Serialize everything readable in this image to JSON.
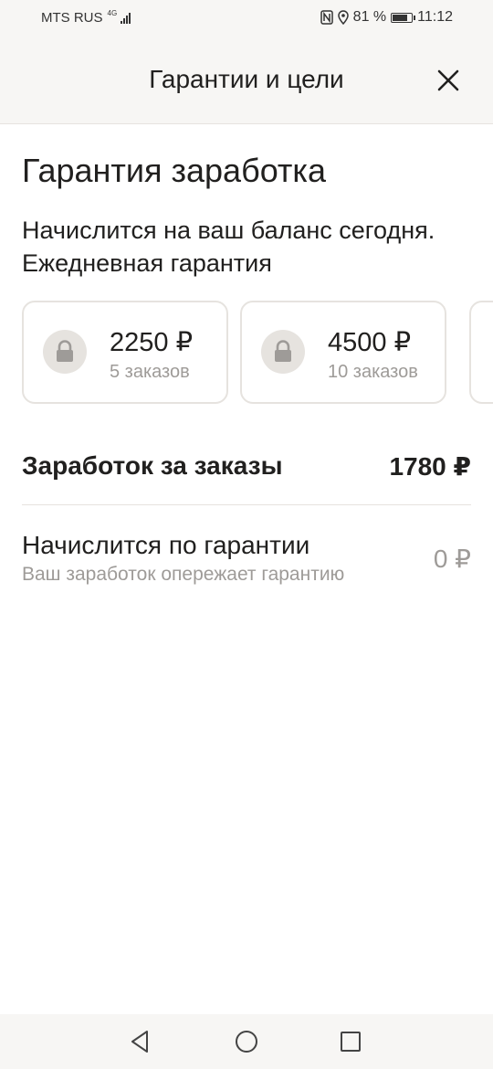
{
  "status_bar": {
    "carrier": "MTS RUS",
    "network": "4G",
    "battery_percent": "81 %",
    "time": "11:12",
    "battery_level": 0.81
  },
  "header": {
    "title": "Гарантии и цели",
    "close_icon": "close-icon"
  },
  "guarantee": {
    "title": "Гарантия заработка",
    "description": "Начислится на ваш баланс сегодня. Ежедневная гарантия",
    "cards": [
      {
        "amount": "2250 ₽",
        "orders": "5 заказов",
        "icon": "lock-icon"
      },
      {
        "amount": "4500 ₽",
        "orders": "10 заказов",
        "icon": "lock-icon"
      }
    ]
  },
  "earnings": {
    "label": "Заработок за заказы",
    "value": "1780 ₽"
  },
  "accrual": {
    "label": "Начислится по гарантии",
    "sublabel": "Ваш заработок опережает гарантию",
    "value": "0 ₽"
  },
  "colors": {
    "background": "#ffffff",
    "header_bg": "#f7f6f4",
    "text_primary": "#21201f",
    "text_secondary": "#9e9b98",
    "border": "#e6e3df"
  }
}
